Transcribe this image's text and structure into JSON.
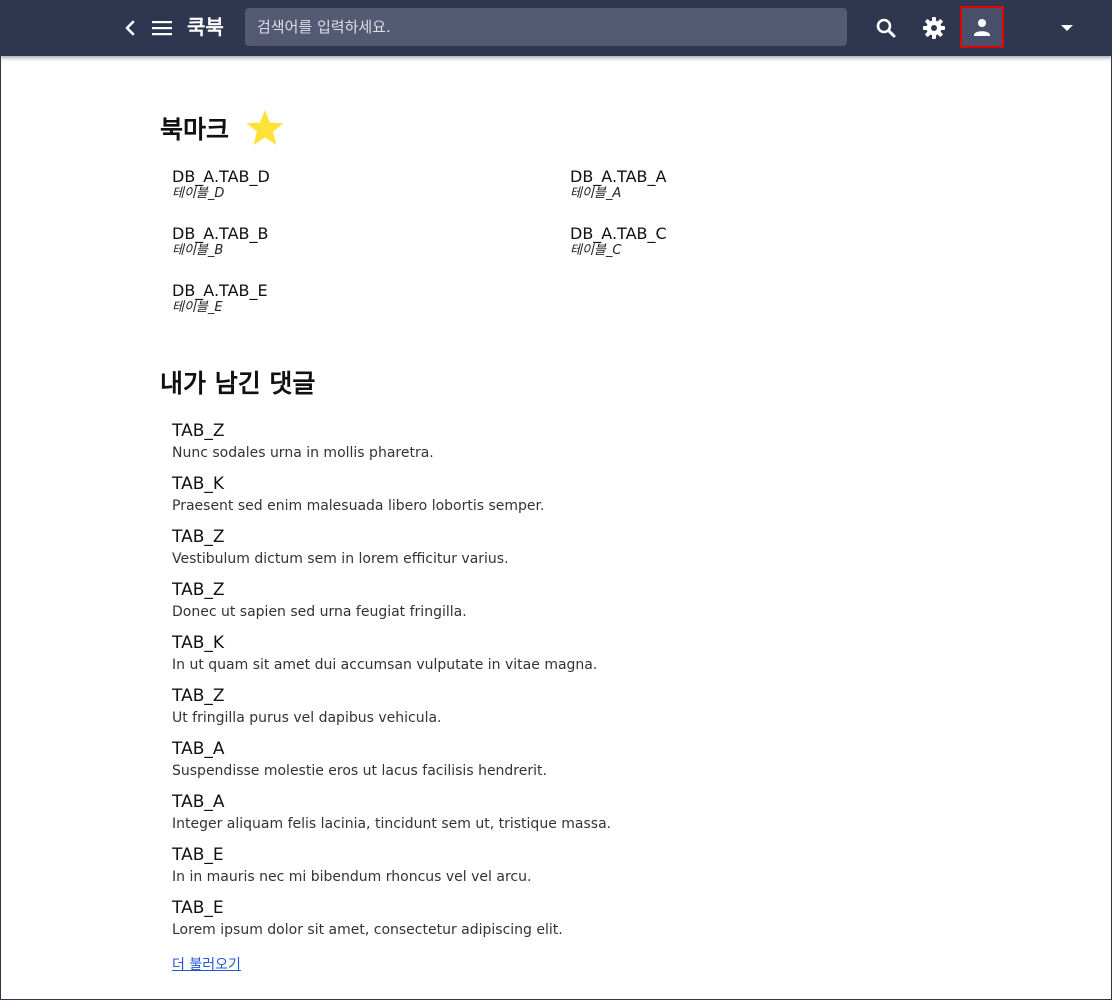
{
  "app": {
    "title": "쿡북"
  },
  "search": {
    "placeholder": "검색어를 입력하세요.",
    "value": ""
  },
  "icons": {
    "back": "chevron-left-icon",
    "menu": "hamburger-menu-icon",
    "dropdown": "caret-down-icon",
    "search": "search-icon",
    "settings": "gear-icon",
    "account": "person-icon",
    "bookmark_star": "star-icon"
  },
  "colors": {
    "topbar": "#2f3650",
    "search_bg": "#545a74",
    "star": "#fde23a",
    "link": "#2156d9",
    "highlight_box": "#e60000"
  },
  "bookmarks": {
    "title": "북마크",
    "items": [
      {
        "name": "DB_A.TAB_D",
        "desc": "테이블_D"
      },
      {
        "name": "DB_A.TAB_A",
        "desc": "테이블_A"
      },
      {
        "name": "DB_A.TAB_B",
        "desc": "테이블_B"
      },
      {
        "name": "DB_A.TAB_C",
        "desc": "테이블_C"
      },
      {
        "name": "DB_A.TAB_E",
        "desc": "테이블_E"
      }
    ]
  },
  "comments": {
    "title": "내가 남긴 댓글",
    "items": [
      {
        "table": "TAB_Z",
        "text": "Nunc sodales urna in mollis pharetra."
      },
      {
        "table": "TAB_K",
        "text": "Praesent sed enim malesuada libero lobortis semper."
      },
      {
        "table": "TAB_Z",
        "text": "Vestibulum dictum sem in lorem efficitur varius."
      },
      {
        "table": "TAB_Z",
        "text": "Donec ut sapien sed urna feugiat fringilla."
      },
      {
        "table": "TAB_K",
        "text": "In ut quam sit amet dui accumsan vulputate in vitae magna."
      },
      {
        "table": "TAB_Z",
        "text": "Ut fringilla purus vel dapibus vehicula."
      },
      {
        "table": "TAB_A",
        "text": "Suspendisse molestie eros ut lacus facilisis hendrerit."
      },
      {
        "table": "TAB_A",
        "text": "Integer aliquam felis lacinia, tincidunt sem ut, tristique massa."
      },
      {
        "table": "TAB_E",
        "text": "In in mauris nec mi bibendum rhoncus vel vel arcu."
      },
      {
        "table": "TAB_E",
        "text": "Lorem ipsum dolor sit amet, consectetur adipiscing elit."
      }
    ],
    "load_more": "더 불러오기"
  }
}
